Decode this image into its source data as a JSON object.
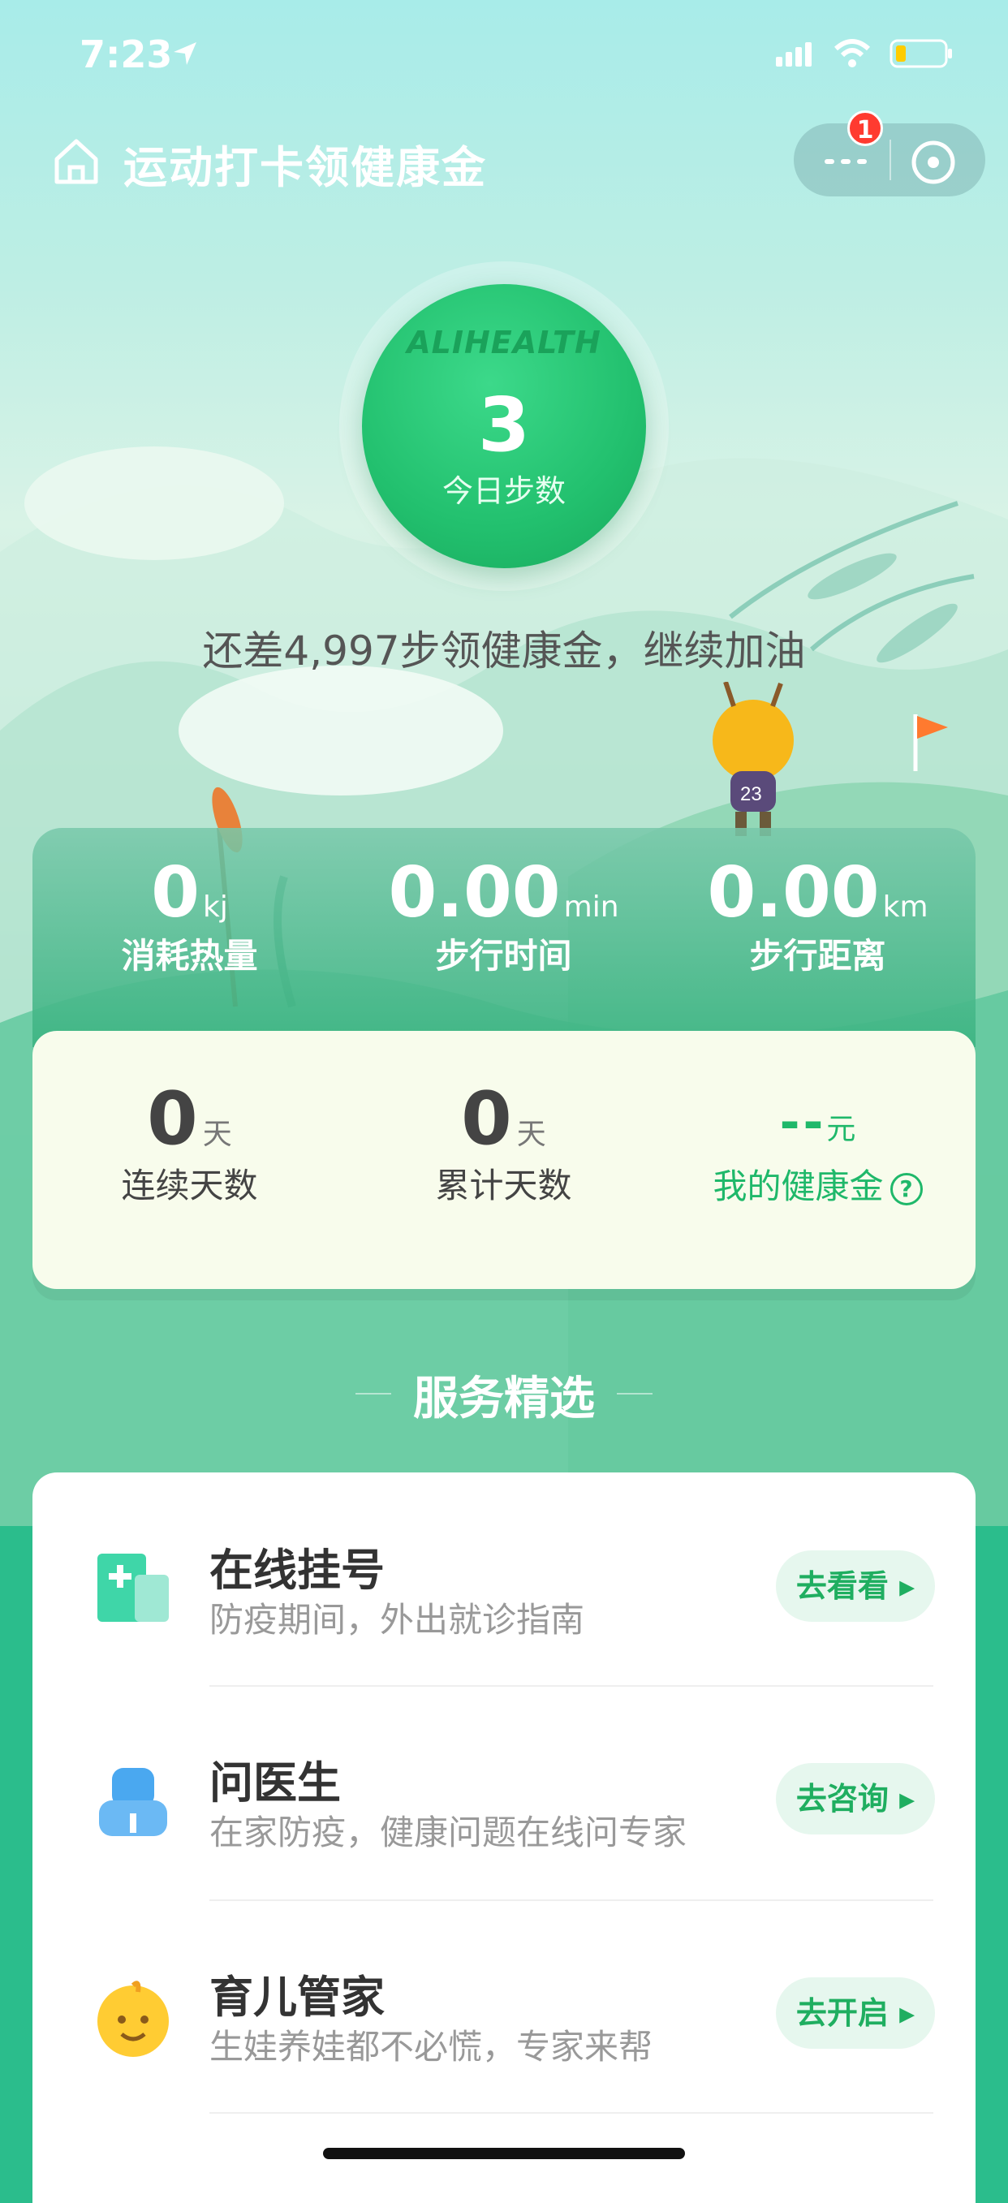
{
  "status_bar": {
    "time": "7:23"
  },
  "header": {
    "title": "运动打卡领健康金",
    "notification_count": "1"
  },
  "steps": {
    "brand": "ALIHEALTH",
    "count": "3",
    "label": "今日步数"
  },
  "hint": "还差4,997步领健康金，继续加油",
  "stats": [
    {
      "value": "0",
      "unit": "kj",
      "label": "消耗热量"
    },
    {
      "value": "0.00",
      "unit": "min",
      "label": "步行时间"
    },
    {
      "value": "0.00",
      "unit": "km",
      "label": "步行距离"
    }
  ],
  "summary": [
    {
      "value": "0",
      "unit": "天",
      "label": "连续天数"
    },
    {
      "value": "0",
      "unit": "天",
      "label": "累计天数"
    },
    {
      "value": "--",
      "unit": "元",
      "label": "我的健康金",
      "help": "?"
    }
  ],
  "section_title": "服务精选",
  "services": [
    {
      "title": "在线挂号",
      "subtitle": "防疫期间，外出就诊指南",
      "button": "去看看",
      "icon": "hospital-icon"
    },
    {
      "title": "问医生",
      "subtitle": "在家防疫，健康问题在线问专家",
      "button": "去咨询",
      "icon": "doctor-icon"
    },
    {
      "title": "育儿管家",
      "subtitle": "生娃养娃都不必慌，专家来帮",
      "button": "去开启",
      "icon": "baby-icon"
    }
  ],
  "colors": {
    "accent": "#1fb86a",
    "background": "#2bbd8c",
    "card": "#f8fcec"
  }
}
